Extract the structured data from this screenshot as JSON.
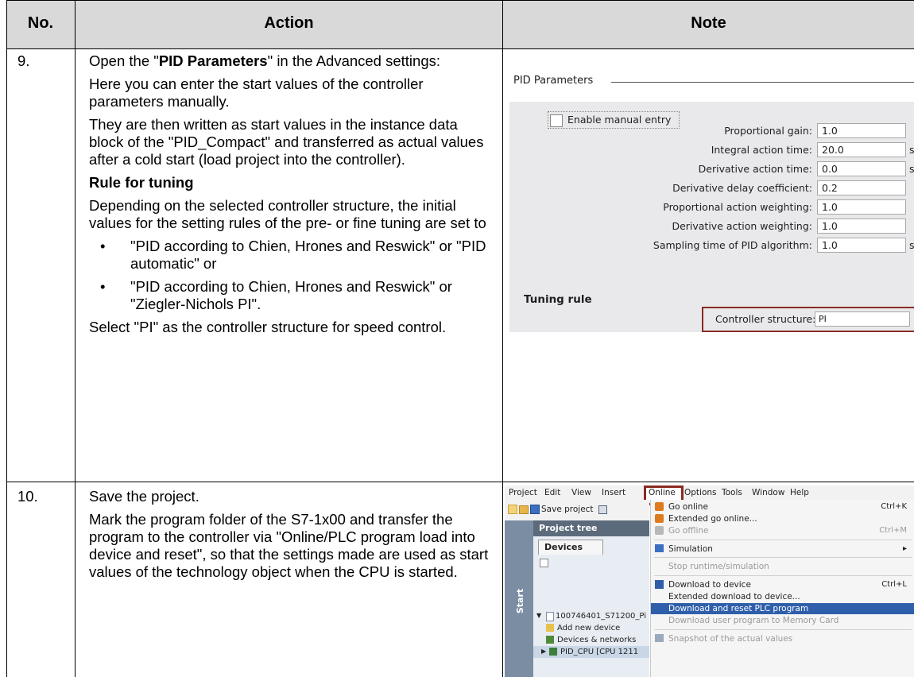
{
  "header": {
    "col1": "No.",
    "col2": "Action",
    "col3": "Note"
  },
  "row9": {
    "number": "9.",
    "intro_before": "Open the \"",
    "intro_bold": "PID Parameters",
    "intro_after": "\" in the Advanced settings:",
    "p2": "Here you can enter the start values of the controller parameters manually.",
    "p3": "They are then written as start values in the instance data block of the \"PID_Compact\" and transferred as actual values after a cold start (load project into the controller).",
    "rule_heading": "Rule for tuning",
    "p4": "Depending on the selected controller structure, the initial values for the setting rules of the pre- or fine tuning are set to",
    "bullet_char": "•",
    "bullets": [
      "\"PID according to Chien, Hrones and Reswick\" or \"PID automatic\" or",
      "\"PID according to Chien, Hrones and Reswick\" or \"Ziegler-Nichols PI\"."
    ],
    "p5": "Select \"PI\" as the controller structure for speed control."
  },
  "row10": {
    "number": "10.",
    "p1": "Save the project.",
    "p2": "Mark the program folder of the S7-1x00 and transfer the program to the controller via \"Online/PLC program load into device and reset\", so that the settings made are used as start values of the technology object when the CPU is started."
  },
  "pid_panel": {
    "title": "PID Parameters",
    "manual_entry": "Enable manual entry",
    "params": [
      {
        "label": "Proportional gain:",
        "value": "1.0",
        "unit": ""
      },
      {
        "label": "Integral action time:",
        "value": "20.0",
        "unit": "s"
      },
      {
        "label": "Derivative action time:",
        "value": "0.0",
        "unit": "s"
      },
      {
        "label": "Derivative delay coefficient:",
        "value": "0.2",
        "unit": ""
      },
      {
        "label": "Proportional action weighting:",
        "value": "1.0",
        "unit": ""
      },
      {
        "label": "Derivative action weighting:",
        "value": "1.0",
        "unit": ""
      },
      {
        "label": "Sampling time of PID algorithm:",
        "value": "1.0",
        "unit": "s"
      }
    ],
    "tuning_rule": "Tuning rule",
    "controller_structure_label": "Controller structure:",
    "controller_structure_value": "PI",
    "dropdown_arrow": "▾"
  },
  "ide": {
    "menubar": [
      "Project",
      "Edit",
      "View",
      "Insert",
      "Online",
      "Options",
      "Tools",
      "Window",
      "Help"
    ],
    "save_project": "Save project",
    "project_tree": "Project tree",
    "devices_tab": "Devices",
    "start_label": "Start",
    "tree": {
      "project": "100746401_S71200_Pi",
      "add_device": "Add new device",
      "devices_networks": "Devices & networks",
      "plc": "PID_CPU [CPU 1211"
    },
    "online_menu": {
      "go_online": "Go online",
      "go_online_sc": "Ctrl+K",
      "extended_go_online": "Extended go online...",
      "go_offline": "Go offline",
      "go_offline_sc": "Ctrl+M",
      "simulation": "Simulation",
      "submenu_arrow": "▸",
      "stop_runtime": "Stop runtime/simulation",
      "download_to_device": "Download to device",
      "download_sc": "Ctrl+L",
      "extended_download": "Extended download to device...",
      "download_reset": "Download and reset PLC program",
      "download_memory_card": "Download user program to Memory Card",
      "snapshot": "Snapshot of the actual values"
    }
  }
}
